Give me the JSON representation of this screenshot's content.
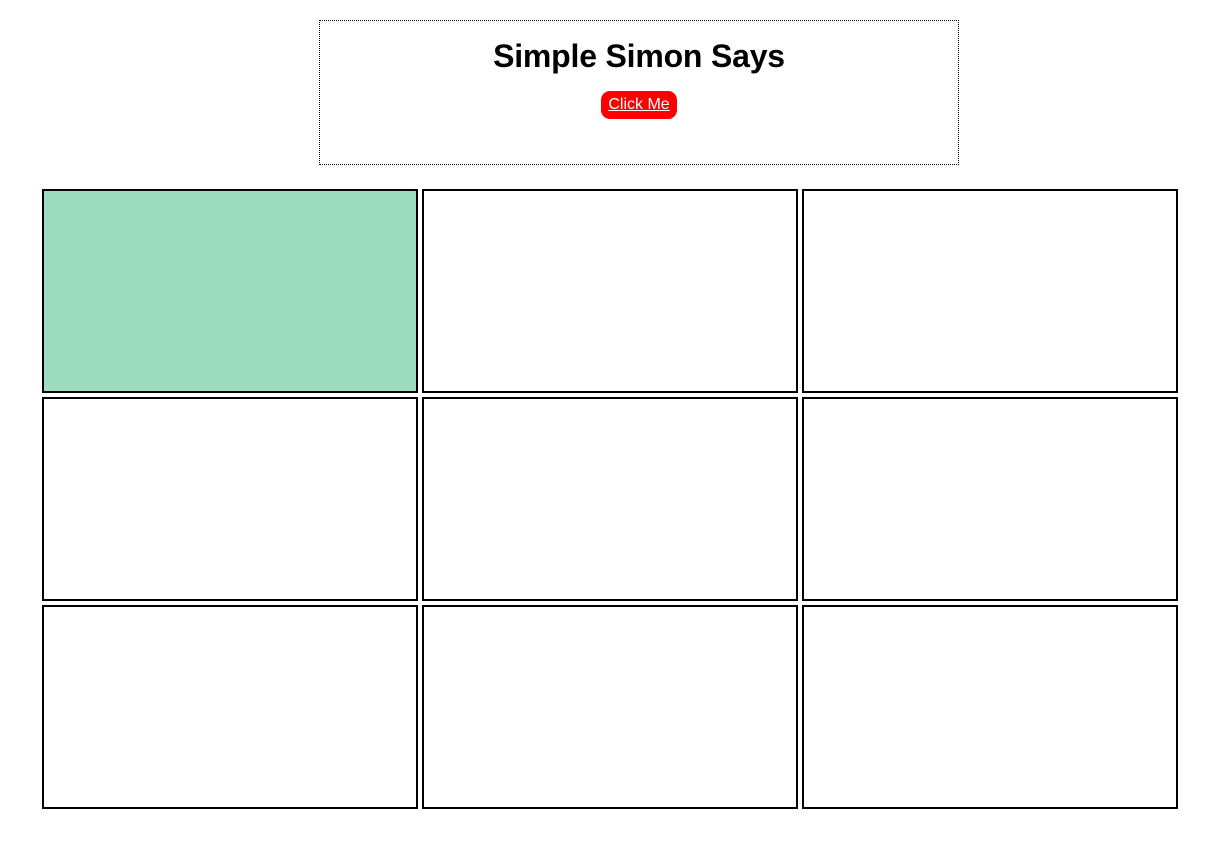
{
  "header": {
    "title": "Simple Simon Says",
    "start_button_label": "Click Me",
    "start_button_color": "#ff0000"
  },
  "board": {
    "tiles": [
      {
        "color": "#9ddcc1",
        "lit": true
      },
      {
        "color": "#ffffff",
        "lit": false
      },
      {
        "color": "#ffffff",
        "lit": false
      },
      {
        "color": "#ffffff",
        "lit": false
      },
      {
        "color": "#ffffff",
        "lit": false
      },
      {
        "color": "#ffffff",
        "lit": false
      },
      {
        "color": "#ffffff",
        "lit": false
      },
      {
        "color": "#ffffff",
        "lit": false
      },
      {
        "color": "#ffffff",
        "lit": false
      }
    ]
  }
}
